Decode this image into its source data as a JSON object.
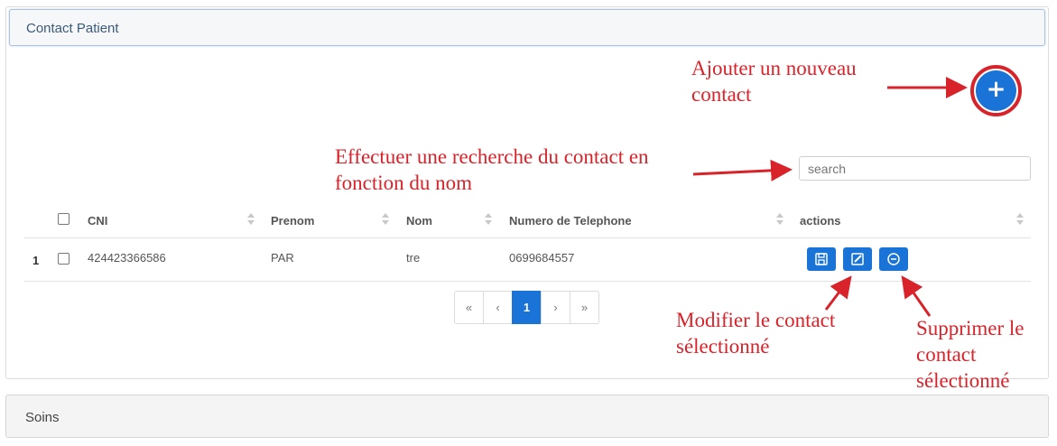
{
  "contact_panel": {
    "title": "Contact Patient",
    "add_button_label": "+",
    "search": {
      "placeholder": "search",
      "value": ""
    },
    "table": {
      "columns": [
        "CNI",
        "Prenom",
        "Nom",
        "Numero de Telephone",
        "actions"
      ],
      "rows": [
        {
          "index": "1",
          "cni": "424423366586",
          "prenom": "PAR",
          "nom": "tre",
          "telephone": "0699684557"
        }
      ]
    },
    "pagination": {
      "first": "«",
      "prev": "‹",
      "current": "1",
      "next": "›",
      "last": "»"
    }
  },
  "annotations": {
    "add": [
      "Ajouter un nouveau",
      "contact"
    ],
    "search": [
      "Effectuer une recherche du contact en",
      "fonction du nom"
    ],
    "edit": [
      "Modifier le contact",
      "sélectionné"
    ],
    "delete": [
      "Supprimer le",
      "contact",
      "sélectionné"
    ]
  },
  "soins_panel": {
    "title": "Soins"
  },
  "colors": {
    "primary": "#1a73d6",
    "annotation": "#d8232a",
    "heading_border": "#a9c3de"
  },
  "icons": [
    "plus-icon",
    "save-icon",
    "edit-icon",
    "minus-circle-icon",
    "sort-icon"
  ]
}
